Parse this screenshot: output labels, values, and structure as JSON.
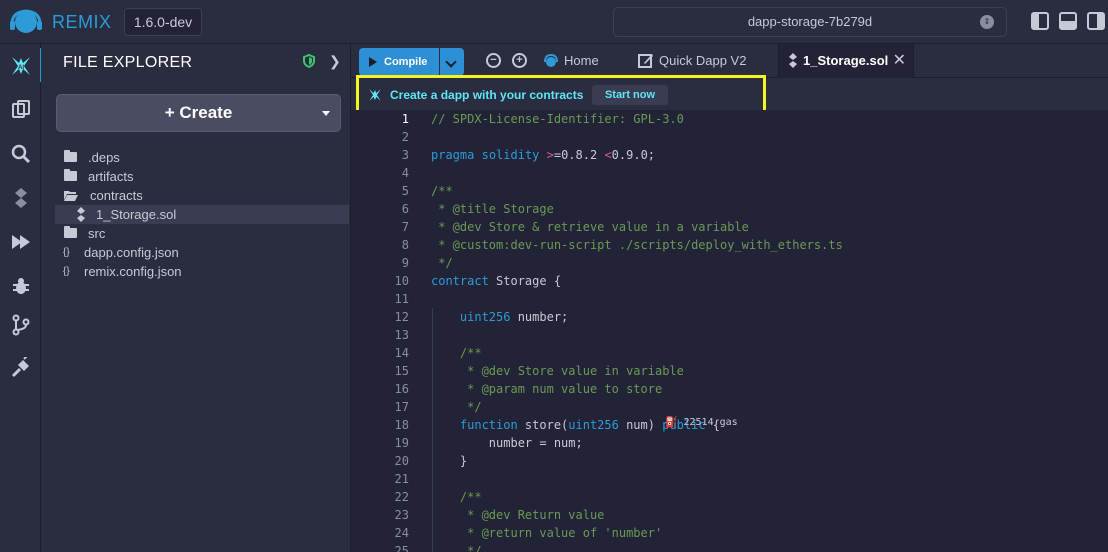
{
  "topbar": {
    "brand": "REMIX",
    "version": "1.6.0-dev",
    "workspace": "dapp-storage-7b279d"
  },
  "sidepanel": {
    "title": "FILE EXPLORER",
    "create_label": "Create",
    "tree": [
      {
        "name": ".deps",
        "type": "folder"
      },
      {
        "name": "artifacts",
        "type": "folder"
      },
      {
        "name": "contracts",
        "type": "folder-open"
      },
      {
        "name": "1_Storage.sol",
        "type": "sol-file",
        "selected": true
      },
      {
        "name": "src",
        "type": "folder"
      },
      {
        "name": "dapp.config.json",
        "type": "json"
      },
      {
        "name": "remix.config.json",
        "type": "json"
      }
    ]
  },
  "tabs": {
    "compile_label": "Compile",
    "home_label": "Home",
    "quickdapp_label": "Quick Dapp V2",
    "active_label": "1_Storage.sol"
  },
  "banner": {
    "text": "Create a dapp with your contracts",
    "button": "Start now"
  },
  "editor": {
    "gas_label": "22514 gas",
    "lines": [
      {
        "n": "1",
        "segs": [
          [
            "cm",
            "// SPDX-License-Identifier: GPL-3.0"
          ]
        ]
      },
      {
        "n": "2",
        "segs": []
      },
      {
        "n": "3",
        "segs": [
          [
            "kw",
            "pragma"
          ],
          [
            "",
            " "
          ],
          [
            "kw",
            "solidity"
          ],
          [
            "",
            " "
          ],
          [
            "op",
            ">"
          ],
          [
            "",
            "=0.8.2 "
          ],
          [
            "op",
            "<"
          ],
          [
            "",
            "0.9.0;"
          ]
        ]
      },
      {
        "n": "4",
        "segs": []
      },
      {
        "n": "5",
        "segs": [
          [
            "cm",
            "/**"
          ]
        ]
      },
      {
        "n": "6",
        "segs": [
          [
            "cm",
            " * @title Storage"
          ]
        ]
      },
      {
        "n": "7",
        "segs": [
          [
            "cm",
            " * @dev Store & retrieve value in a variable"
          ]
        ]
      },
      {
        "n": "8",
        "segs": [
          [
            "cm",
            " * @custom:dev-run-script ./scripts/deploy_with_ethers.ts"
          ]
        ]
      },
      {
        "n": "9",
        "segs": [
          [
            "cm",
            " */"
          ]
        ]
      },
      {
        "n": "10",
        "segs": [
          [
            "kw",
            "contract"
          ],
          [
            "",
            " Storage {"
          ]
        ]
      },
      {
        "n": "11",
        "segs": []
      },
      {
        "n": "12",
        "segs": [
          [
            "",
            "    "
          ],
          [
            "ty",
            "uint256"
          ],
          [
            "",
            " number;"
          ]
        ]
      },
      {
        "n": "13",
        "segs": []
      },
      {
        "n": "14",
        "segs": [
          [
            "cm",
            "    /**"
          ]
        ]
      },
      {
        "n": "15",
        "segs": [
          [
            "cm",
            "     * @dev Store value in variable"
          ]
        ]
      },
      {
        "n": "16",
        "segs": [
          [
            "cm",
            "     * @param num value to store"
          ]
        ]
      },
      {
        "n": "17",
        "segs": [
          [
            "cm",
            "     */"
          ]
        ]
      },
      {
        "n": "18",
        "segs": [
          [
            "",
            "    "
          ],
          [
            "kw",
            "function"
          ],
          [
            "",
            " store("
          ],
          [
            "ty",
            "uint256"
          ],
          [
            "",
            " num) "
          ],
          [
            "kw",
            "public"
          ],
          [
            "",
            " {"
          ]
        ]
      },
      {
        "n": "19",
        "segs": [
          [
            "",
            "        number = num;"
          ]
        ]
      },
      {
        "n": "20",
        "segs": [
          [
            "",
            "    }"
          ]
        ]
      },
      {
        "n": "21",
        "segs": []
      },
      {
        "n": "22",
        "segs": [
          [
            "cm",
            "    /**"
          ]
        ]
      },
      {
        "n": "23",
        "segs": [
          [
            "cm",
            "     * @dev Return value"
          ]
        ]
      },
      {
        "n": "24",
        "segs": [
          [
            "cm",
            "     * @return value of 'number'"
          ]
        ]
      },
      {
        "n": "25",
        "segs": [
          [
            "cm",
            "     */"
          ]
        ]
      }
    ]
  }
}
